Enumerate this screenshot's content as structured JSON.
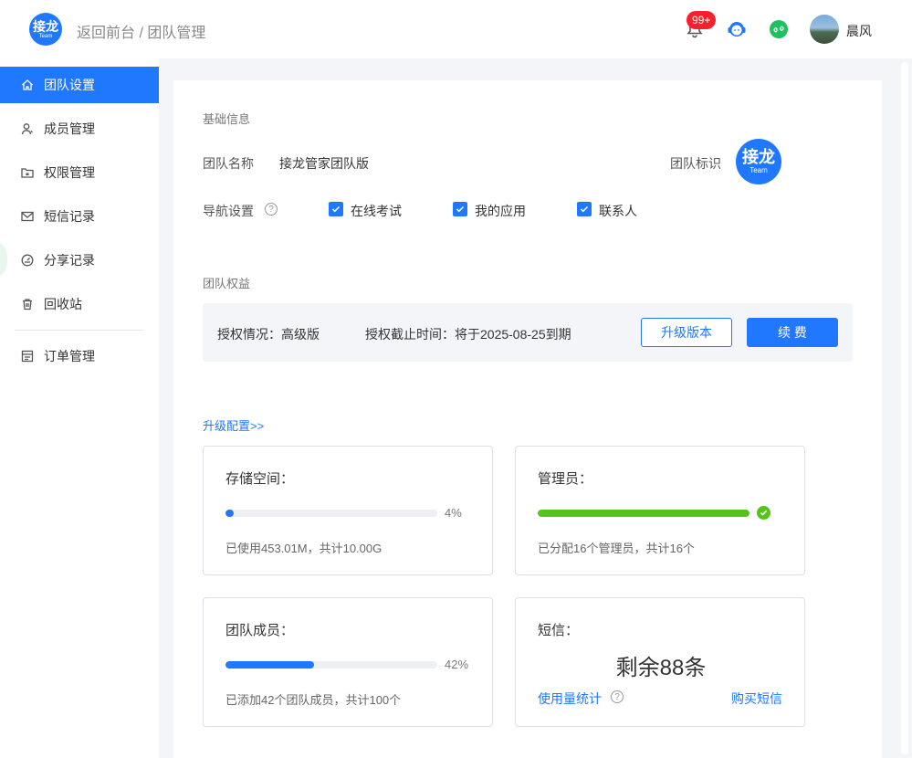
{
  "header": {
    "logo_text": "接龙",
    "logo_sub": "Team",
    "breadcrumb": "返回前台 / 团队管理",
    "notification_badge": "99+",
    "username": "晨风"
  },
  "sidebar": {
    "items": [
      {
        "label": "团队设置",
        "icon": "home-icon",
        "active": true
      },
      {
        "label": "成员管理",
        "icon": "user-icon"
      },
      {
        "label": "权限管理",
        "icon": "folder-lock-icon"
      },
      {
        "label": "短信记录",
        "icon": "mail-icon"
      },
      {
        "label": "分享记录",
        "icon": "gauge-icon"
      },
      {
        "label": "回收站",
        "icon": "trash-icon"
      },
      {
        "label": "订单管理",
        "icon": "order-icon"
      }
    ]
  },
  "basic": {
    "section_title": "基础信息",
    "team_name_label": "团队名称",
    "team_name_value": "接龙管家团队版",
    "team_logo_label": "团队标识",
    "team_logo_text": "接龙",
    "team_logo_sub": "Team",
    "nav_label": "导航设置",
    "nav_options": [
      {
        "label": "在线考试",
        "checked": true
      },
      {
        "label": "我的应用",
        "checked": true
      },
      {
        "label": "联系人",
        "checked": true
      }
    ]
  },
  "rights": {
    "section_title": "团队权益",
    "license_text": "授权情况：高级版",
    "expiry_text": "授权截止时间：将于2025-08-25到期",
    "upgrade_button": "升级版本",
    "renew_button": "续 费"
  },
  "upgrade_link": "升级配置>>",
  "cards": {
    "storage": {
      "title": "存储空间：",
      "percent": 4,
      "percent_text": "4%",
      "desc": "已使用453.01M，共计10.00G"
    },
    "admins": {
      "title": "管理员：",
      "percent": 100,
      "desc": "已分配16个管理员，共计16个"
    },
    "members": {
      "title": "团队成员：",
      "percent": 42,
      "percent_text": "42%",
      "desc": "已添加42个团队成员，共计100个"
    },
    "sms": {
      "title": "短信：",
      "remaining": "剩余88条",
      "usage_link": "使用量统计",
      "buy_link": "购买短信"
    }
  },
  "colors": {
    "primary": "#1f78ff",
    "success": "#52c41a",
    "badge": "#f5222d"
  }
}
